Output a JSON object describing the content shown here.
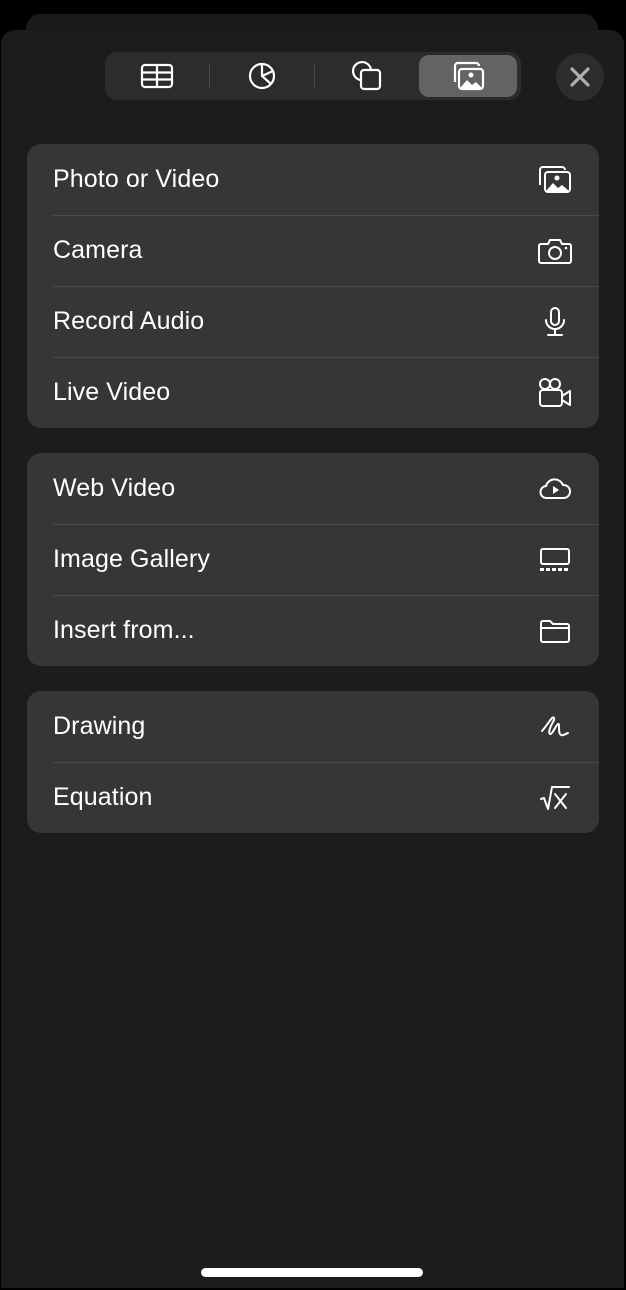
{
  "toolbar": {
    "tabs": [
      {
        "name": "table",
        "icon": "table-icon",
        "active": false
      },
      {
        "name": "chart",
        "icon": "pie-chart-icon",
        "active": false
      },
      {
        "name": "shape",
        "icon": "shapes-icon",
        "active": false
      },
      {
        "name": "media",
        "icon": "photos-icon",
        "active": true
      }
    ],
    "close_icon": "close-icon"
  },
  "groups": [
    {
      "items": [
        {
          "label": "Photo or Video",
          "icon": "photo-stack-icon"
        },
        {
          "label": "Camera",
          "icon": "camera-icon"
        },
        {
          "label": "Record Audio",
          "icon": "microphone-icon"
        },
        {
          "label": "Live Video",
          "icon": "video-camera-icon"
        }
      ]
    },
    {
      "items": [
        {
          "label": "Web Video",
          "icon": "cloud-play-icon"
        },
        {
          "label": "Image Gallery",
          "icon": "image-gallery-icon"
        },
        {
          "label": "Insert from...",
          "icon": "folder-icon"
        }
      ]
    },
    {
      "items": [
        {
          "label": "Drawing",
          "icon": "scribble-icon"
        },
        {
          "label": "Equation",
          "icon": "square-root-icon"
        }
      ]
    }
  ],
  "colors": {
    "background": "#1c1c1e",
    "group_background": "#363638",
    "segment_background": "#2c2c2e",
    "segment_active": "#636366",
    "text": "#ffffff"
  }
}
